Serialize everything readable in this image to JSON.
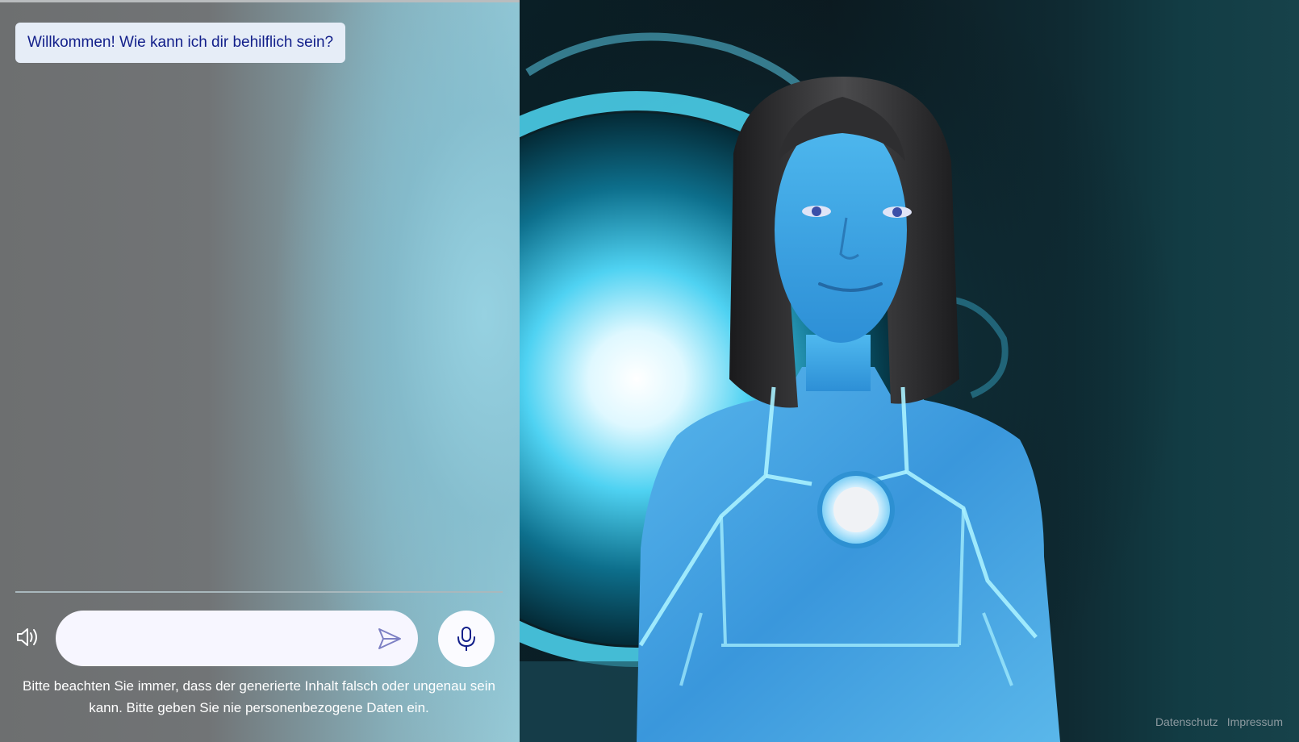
{
  "chat": {
    "welcome_message": "Willkommen! Wie kann ich dir behilflich sein?",
    "input_value": "",
    "input_placeholder": "",
    "disclaimer": "Bitte beachten Sie immer, dass der generierte Inhalt falsch oder ungenau sein kann. Bitte geben Sie nie personenbezogene Daten ein.",
    "icons": {
      "speaker": "speaker-icon",
      "send": "send-icon",
      "microphone": "microphone-icon"
    }
  },
  "footer": {
    "privacy_label": "Datenschutz",
    "imprint_label": "Impressum"
  },
  "colors": {
    "accent": "#121f8a",
    "bubble_bg": "#e6edf7",
    "avatar_glow": "#39c8ff"
  }
}
